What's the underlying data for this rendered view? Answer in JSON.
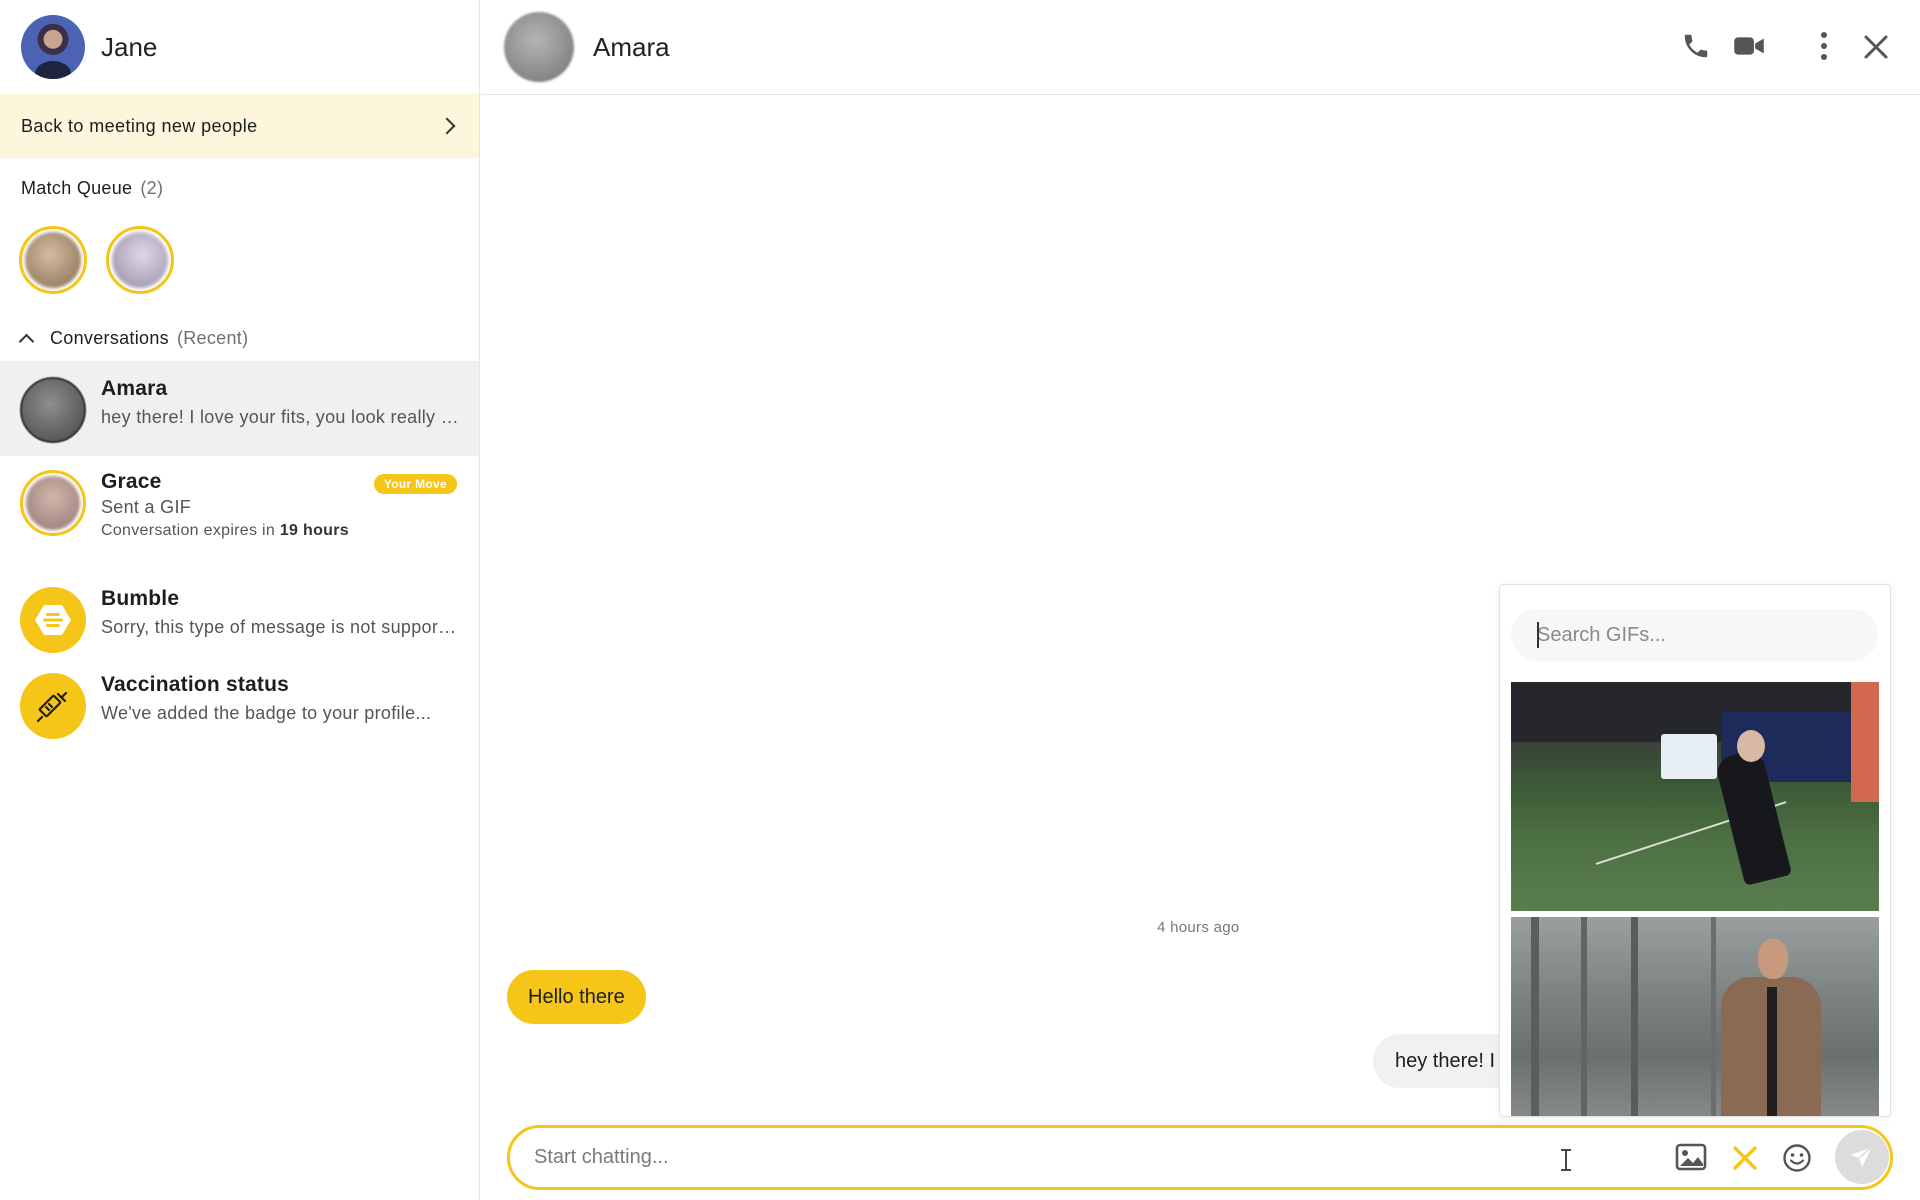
{
  "user": {
    "name": "Jane"
  },
  "banner": {
    "label": "Back to meeting new people"
  },
  "match_queue": {
    "label": "Match Queue",
    "count": "(2)"
  },
  "conversations_section": {
    "label": "Conversations",
    "sub": "(Recent)"
  },
  "conversations": [
    {
      "name": "Amara",
      "preview": "hey there! I love your fits, you look really good!"
    },
    {
      "name": "Grace",
      "preview": "Sent a GIF",
      "badge": "Your Move",
      "expires_prefix": "Conversation expires in",
      "expires_value": "19 hours"
    },
    {
      "name": "Bumble",
      "preview": "Sorry, this type of message is not supported"
    },
    {
      "name": "Vaccination status",
      "preview": "We've added the badge to your profile..."
    }
  ],
  "chat": {
    "name": "Amara",
    "timestamp": "4 hours ago",
    "messages": [
      {
        "from": "me",
        "text": "Hello there"
      },
      {
        "from": "them",
        "text": "hey there! I love your fits, you look really good!"
      }
    ]
  },
  "gif_panel": {
    "placeholder": "Search GIFs..."
  },
  "composer": {
    "placeholder": "Start chatting..."
  },
  "colors": {
    "accent": "#f5c518",
    "banner_bg": "#fdf5dc",
    "active_row": "#f0f0f0"
  }
}
